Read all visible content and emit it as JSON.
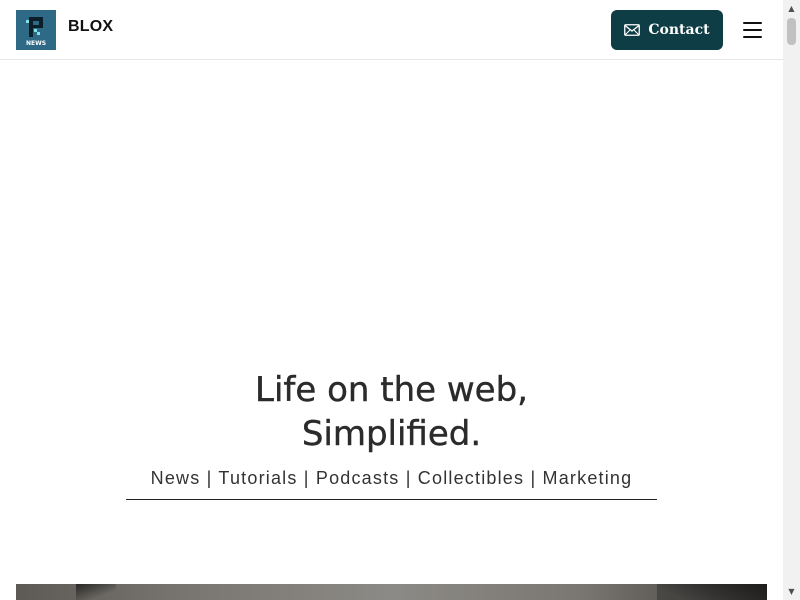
{
  "header": {
    "brand": "BLOX",
    "logo_text": "NEWS",
    "contact_label": "Contact",
    "contact_icon": "envelope-icon",
    "menu_icon": "hamburger-menu-icon"
  },
  "hero": {
    "title_line1": "Life on the web,",
    "title_line2": "Simplified.",
    "nav": [
      {
        "label": "News"
      },
      {
        "label": "Tutorials"
      },
      {
        "label": "Podcasts"
      },
      {
        "label": "Collectibles"
      },
      {
        "label": "Marketing"
      }
    ],
    "separator": "|"
  },
  "colors": {
    "logo_bg": "#2e6a86",
    "contact_bg": "#0f3d45",
    "text": "#2b2b2b"
  }
}
